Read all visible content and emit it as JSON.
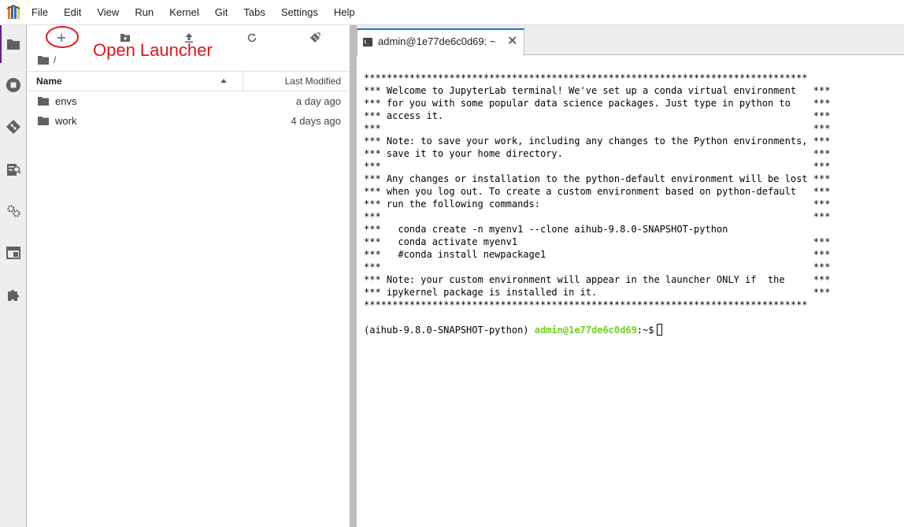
{
  "menubar": {
    "items": [
      "File",
      "Edit",
      "View",
      "Run",
      "Kernel",
      "Git",
      "Tabs",
      "Settings",
      "Help"
    ]
  },
  "activity_bar": {
    "icons": [
      "folder-icon",
      "running-sessions-icon",
      "git-icon",
      "property-inspector-icon",
      "extension-settings-icon",
      "tabs-icon",
      "extension-manager-icon"
    ]
  },
  "file_browser": {
    "toolbar": {
      "buttons": [
        "new-launcher-icon",
        "new-folder-icon",
        "upload-icon",
        "refresh-icon",
        "git-clone-icon"
      ],
      "annotation": "Open Launcher"
    },
    "breadcrumb": "/",
    "columns": {
      "name": "Name",
      "modified": "Last Modified"
    },
    "items": [
      {
        "name": "envs",
        "modified": "a day ago"
      },
      {
        "name": "work",
        "modified": "4 days ago"
      }
    ]
  },
  "tab": {
    "title": "admin@1e77de6c0d69: ~",
    "close": "✕"
  },
  "terminal": {
    "lines": [
      "******************************************************************************",
      "*** Welcome to JupyterLab terminal! We've set up a conda virtual environment   ***",
      "*** for you with some popular data science packages. Just type in python to    ***",
      "*** access it.                                                                 ***",
      "***                                                                            ***",
      "*** Note: to save your work, including any changes to the Python environments, ***",
      "*** save it to your home directory.                                            ***",
      "***                                                                            ***",
      "*** Any changes or installation to the python-default environment will be lost ***",
      "*** when you log out. To create a custom environment based on python-default   ***",
      "*** run the following commands:                                                ***",
      "***                                                                            ***",
      "***   conda create -n myenv1 --clone aihub-9.8.0-SNAPSHOT-python",
      "***   conda activate myenv1                                                    ***",
      "***   #conda install newpackage1                                               ***",
      "***                                                                            ***",
      "*** Note: your custom environment will appear in the launcher ONLY if  the     ***",
      "*** ipykernel package is installed in it.                                      ***",
      "******************************************************************************"
    ],
    "prompt_env": "(aihub-9.8.0-SNAPSHOT-python) ",
    "prompt_user": "admin@1e77de6c0d69",
    "prompt_suffix": ":~$"
  }
}
